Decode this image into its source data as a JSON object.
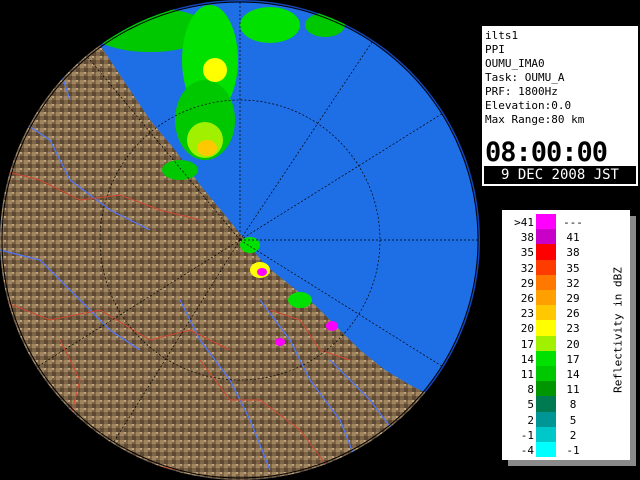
{
  "info": {
    "radar": "ilts1",
    "product": "PPI",
    "site": "OUMU_IMA0",
    "task": "Task: OUMU_A",
    "prf": "PRF: 1800Hz",
    "elevation": "Elevation:0.0",
    "max_range": "Max Range:80 km",
    "time": "08:00:00",
    "date": "9 DEC 2008 JST"
  },
  "legend": {
    "title": "Reflectivity in dBZ",
    "rows": [
      {
        "lo": ">41",
        "hi": "---",
        "color": "#ff00ff"
      },
      {
        "lo": "38",
        "hi": "41",
        "color": "#c800c8"
      },
      {
        "lo": "35",
        "hi": "38",
        "color": "#ff0000"
      },
      {
        "lo": "32",
        "hi": "35",
        "color": "#ff3c00"
      },
      {
        "lo": "29",
        "hi": "32",
        "color": "#ff7800"
      },
      {
        "lo": "26",
        "hi": "29",
        "color": "#ffa000"
      },
      {
        "lo": "23",
        "hi": "26",
        "color": "#ffc800"
      },
      {
        "lo": "20",
        "hi": "23",
        "color": "#ffff00"
      },
      {
        "lo": "17",
        "hi": "20",
        "color": "#a0f000"
      },
      {
        "lo": "14",
        "hi": "17",
        "color": "#00e100"
      },
      {
        "lo": "11",
        "hi": "14",
        "color": "#00c800"
      },
      {
        "lo": "8",
        "hi": "11",
        "color": "#009600"
      },
      {
        "lo": "5",
        "hi": "8",
        "color": "#007a50"
      },
      {
        "lo": "2",
        "hi": "5",
        "color": "#009696"
      },
      {
        "lo": "-1",
        "hi": "2",
        "color": "#00c8c8"
      },
      {
        "lo": "-4",
        "hi": "-1",
        "color": "#00ffff"
      }
    ]
  },
  "map": {
    "ocean_color": "#1e6ee6",
    "outer_color": "#1446b4",
    "land_color": "#7d6446"
  }
}
